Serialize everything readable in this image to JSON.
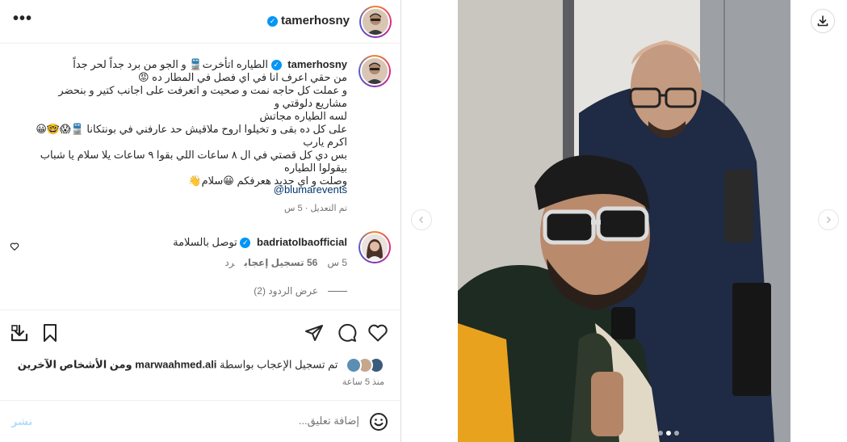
{
  "header": {
    "username": "tamerhosny",
    "more_label": "•••"
  },
  "caption": {
    "username": "tamerhosny",
    "lines": [
      "الطياره اتأخرت🚆 و الجو من برد جداً لحر جداً",
      "من حقي اعرف انا في اي فصل في المطار ده 😡",
      "و عملت كل حاجه نمت و صحيت و اتعرفت على اجانب كتير و بنحضر مشاريع دلوقتي و",
      "لسه الطياره مجاتش",
      "على كل ده بقى و تخيلوا اروح ملاقيش حد عارفني في بونتكانا 🚆😱🤓😀 اكرم يارب",
      "بس دي كل قصتي في ال ٨ ساعات اللي بقوا ٩ ساعات يلا سلام يا شباب بيقولوا الطياره",
      "وصلت و اي جديد هعرفكم 😀سلام👋"
    ],
    "mention": "@blumarevents",
    "edited": "تم التعديل · 5 س"
  },
  "comment": {
    "username": "badriatolbaofficial",
    "text": "توصل بالسلامة",
    "time": "5 س",
    "likes": "56 تسجيل إعجاب",
    "reply": "رد",
    "view_replies": "عرض الردود (2)"
  },
  "likes": {
    "prefix": "تم تسجيل الإعجاب بواسطة",
    "user": "marwaahmed.ali",
    "suffix": "ومن الأشخاص الآخرين"
  },
  "time_ago": "منذ 5 ساعة",
  "comment_box": {
    "placeholder": "إضافة تعليق...",
    "post_label": "نشر"
  },
  "carousel": {
    "total": 3,
    "active": 1
  },
  "colors": {
    "verified": "#0095f6",
    "link": "#00376b",
    "post_disabled": "#b3dbff"
  },
  "icons": {
    "header_more": "more-horizontal-icon",
    "like": "heart-icon",
    "comment": "comment-icon",
    "share": "send-icon",
    "save": "bookmark-icon",
    "download": "download-icon",
    "emoji": "emoji-icon",
    "prev": "chevron-left-icon",
    "next": "chevron-right-icon"
  }
}
